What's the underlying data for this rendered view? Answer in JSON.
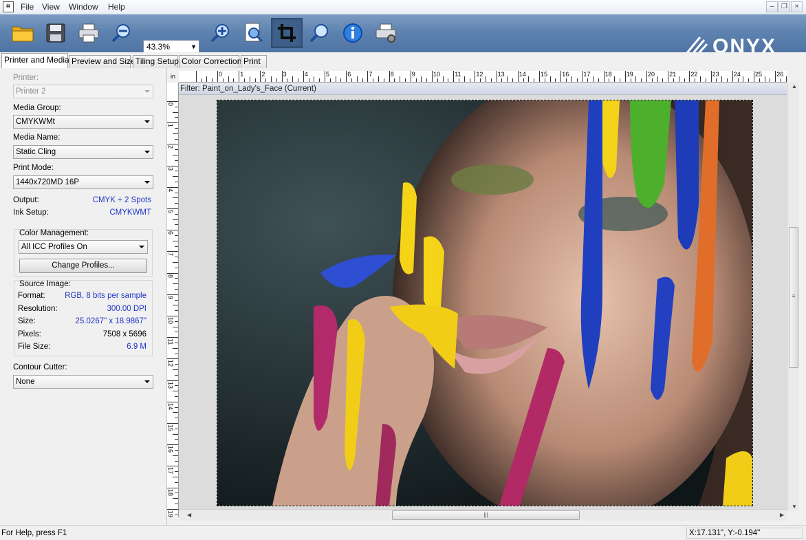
{
  "menubar": {
    "items": [
      "File",
      "View",
      "Window",
      "Help"
    ],
    "window_buttons": {
      "minimize": "–",
      "restore": "❐",
      "close": "×"
    }
  },
  "toolbar": {
    "buttons": [
      "open-folder-icon",
      "save-icon",
      "print-icon",
      "zoom-out-icon",
      "zoom-in-icon",
      "zoom-to-page-icon",
      "crop-icon",
      "zoom-icon",
      "info-icon",
      "printer-settings-icon"
    ],
    "zoom_value": "43.3%",
    "logo_text": "ONYX"
  },
  "tabs": [
    "Printer and Media",
    "Preview and Size",
    "Tiling Setup",
    "Color Correction",
    "Print"
  ],
  "panel": {
    "printer_label": "Printer:",
    "printer_value": "Printer 2",
    "media_group_label": "Media Group:",
    "media_group_value": "CMYKWMt",
    "media_name_label": "Media Name:",
    "media_name_value": "Static Cling",
    "print_mode_label": "Print Mode:",
    "print_mode_value": "1440x720MD 16P",
    "output_label": "Output:",
    "output_value": "CMYK + 2 Spots",
    "ink_setup_label": "Ink Setup:",
    "ink_setup_value": "CMYKWMT",
    "color_mgmt_label": "Color Management:",
    "color_mgmt_value": "All ICC Profiles On",
    "change_profiles_label": "Change Profiles...",
    "source_image_label": "Source Image:",
    "format_label": "Format:",
    "format_value": "RGB, 8 bits per sample",
    "resolution_label": "Resolution:",
    "resolution_value": "300.00 DPI",
    "size_label": "Size:",
    "size_value": "25.0267\" x 18.9867\"",
    "pixels_label": "Pixels:",
    "pixels_value": "7508 x 5696",
    "filesize_label": "File Size:",
    "filesize_value": "6.9 M",
    "contour_label": "Contour Cutter:",
    "contour_value": "None"
  },
  "ruler": {
    "unit": "in",
    "h_labels": [
      "0",
      "1",
      "2",
      "3",
      "4",
      "5",
      "6",
      "7",
      "8",
      "9",
      "10",
      "11",
      "12",
      "13",
      "14",
      "15",
      "16",
      "17",
      "18",
      "19",
      "20",
      "21",
      "22",
      "23",
      "24",
      "25",
      "26"
    ],
    "v_labels": [
      "0",
      "1",
      "2",
      "3",
      "4",
      "5",
      "6",
      "7",
      "8",
      "9",
      "10",
      "11",
      "12",
      "13",
      "14",
      "15",
      "16",
      "17",
      "18",
      "19"
    ]
  },
  "canvas": {
    "filter_text": "Filter: Paint_on_Lady's_Face (Current)"
  },
  "status": {
    "help_text": "For Help, press F1",
    "coords": "X:17.131\", Y:-0.194\""
  }
}
